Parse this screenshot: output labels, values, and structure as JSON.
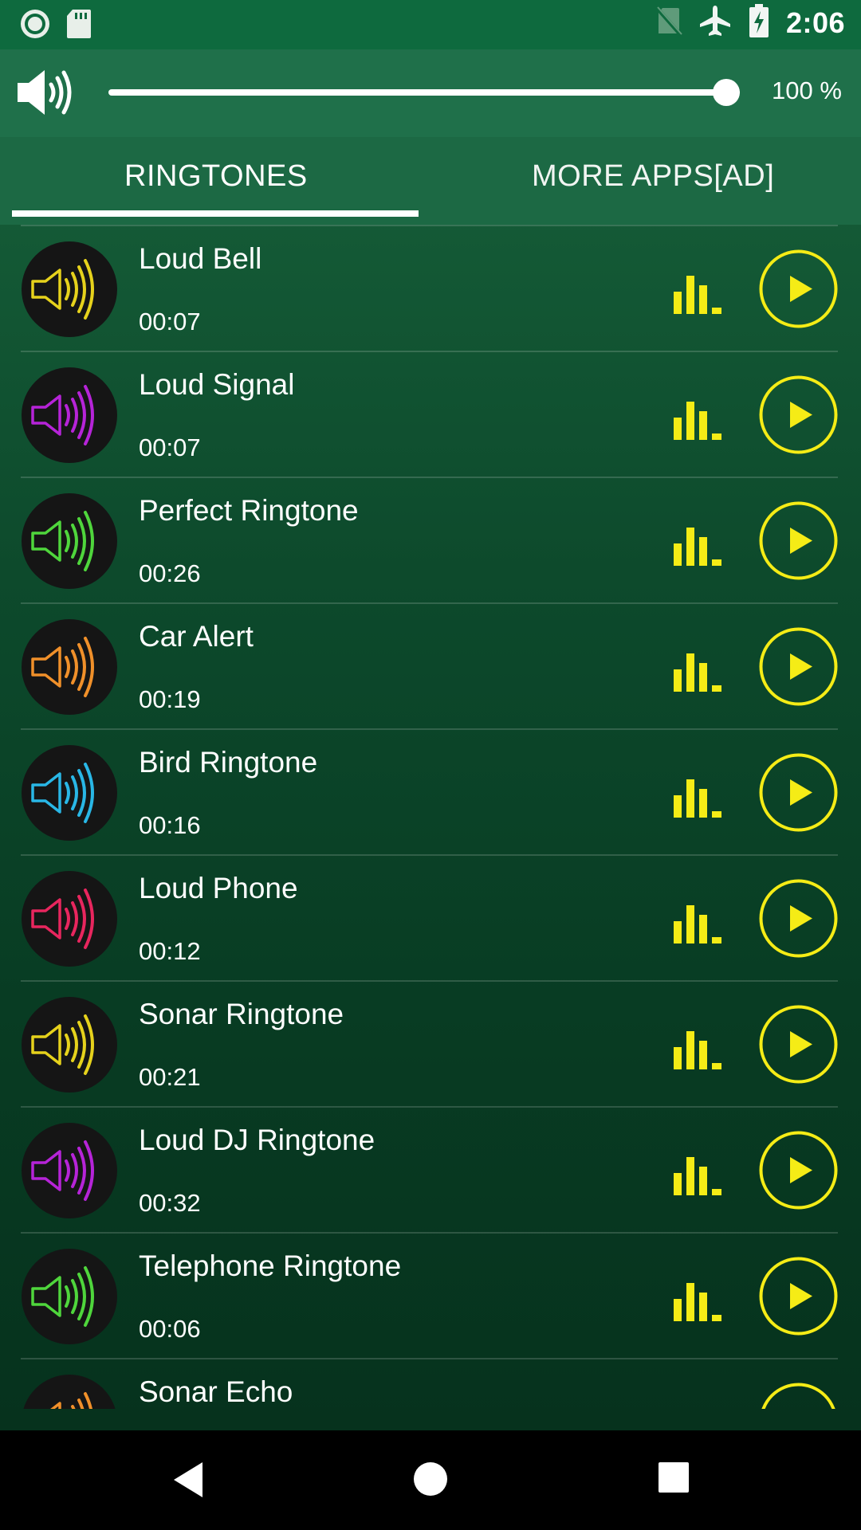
{
  "status_bar": {
    "time": "2:06",
    "icons": [
      "record-icon",
      "sd-card-icon",
      "no-sim-icon",
      "airplane-mode-icon",
      "battery-charging-icon"
    ]
  },
  "volume": {
    "icon": "speaker-icon",
    "percent_label": "100 %",
    "level": 1.0
  },
  "tabs": [
    {
      "label": "RINGTONES",
      "selected": true
    },
    {
      "label": "MORE APPS[AD]",
      "selected": false
    }
  ],
  "ringtones": [
    {
      "title": "Loud Bell",
      "duration": "00:07",
      "color": "#e6d21c"
    },
    {
      "title": "Loud Signal",
      "duration": "00:07",
      "color": "#b624d8"
    },
    {
      "title": "Perfect Ringtone",
      "duration": "00:26",
      "color": "#4fd63c"
    },
    {
      "title": "Car Alert",
      "duration": "00:19",
      "color": "#f0902a"
    },
    {
      "title": "Bird Ringtone",
      "duration": "00:16",
      "color": "#29b7e6"
    },
    {
      "title": "Loud Phone",
      "duration": "00:12",
      "color": "#e8265e"
    },
    {
      "title": "Sonar Ringtone",
      "duration": "00:21",
      "color": "#e6d21c"
    },
    {
      "title": "Loud DJ Ringtone",
      "duration": "00:32",
      "color": "#b624d8"
    },
    {
      "title": "Telephone Ringtone",
      "duration": "00:06",
      "color": "#4fd63c"
    },
    {
      "title": "Sonar Echo",
      "duration": "",
      "color": "#f0902a"
    }
  ],
  "item_icons": {
    "speaker": "speaker-icon",
    "equalizer": "equalizer-icon",
    "play": "play-icon"
  },
  "colors": {
    "accent_yellow": "#f5ec16",
    "tab_indicator": "#ffffff",
    "status_bar": "#0e6a3e"
  },
  "nav": {
    "back": "back-icon",
    "home": "home-icon",
    "recents": "recents-icon"
  }
}
